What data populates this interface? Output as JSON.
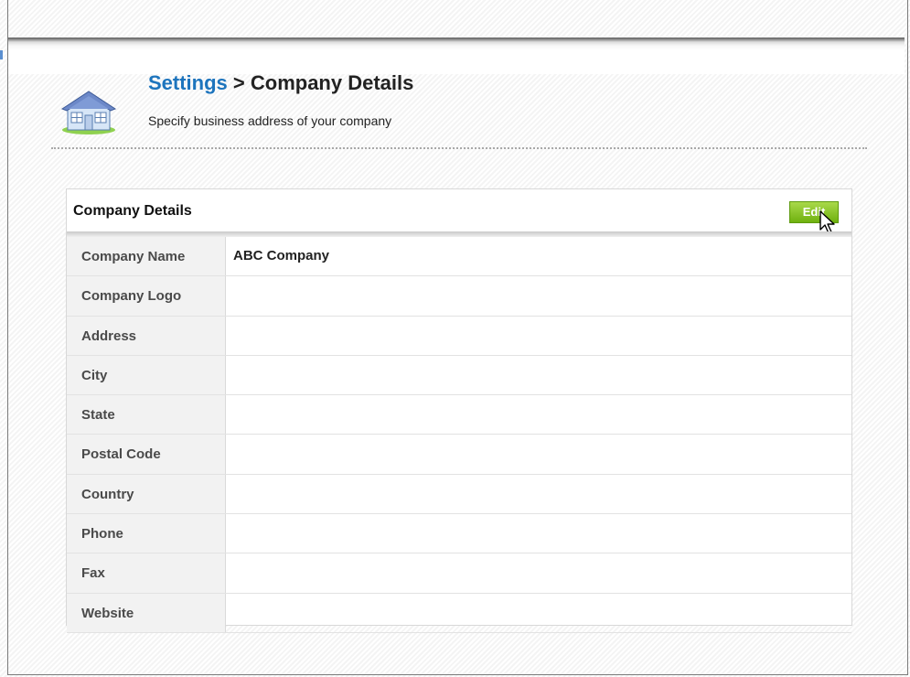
{
  "header": {
    "breadcrumb_link": "Settings",
    "breadcrumb_sep": " > ",
    "breadcrumb_current": "Company Details",
    "subtitle": "Specify business address of your company"
  },
  "panel": {
    "title": "Company Details",
    "edit_label": "Edit",
    "accent_color": "#7ab51d",
    "rows": [
      {
        "label": "Company Name",
        "value": "ABC Company"
      },
      {
        "label": "Company Logo",
        "value": ""
      },
      {
        "label": "Address",
        "value": ""
      },
      {
        "label": "City",
        "value": ""
      },
      {
        "label": "State",
        "value": ""
      },
      {
        "label": "Postal Code",
        "value": ""
      },
      {
        "label": "Country",
        "value": ""
      },
      {
        "label": "Phone",
        "value": ""
      },
      {
        "label": "Fax",
        "value": ""
      },
      {
        "label": "Website",
        "value": ""
      }
    ]
  },
  "icons": {
    "page_icon": "house-icon",
    "cursor": "mouse-pointer-icon"
  }
}
